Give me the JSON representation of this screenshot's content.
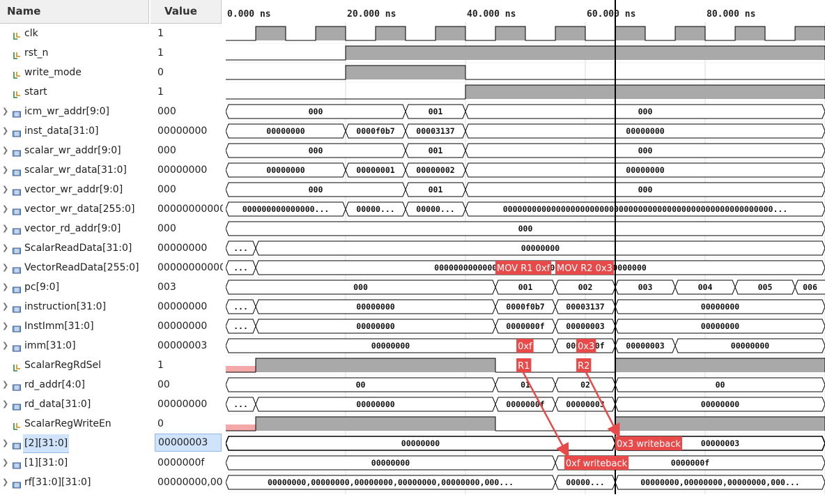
{
  "header": {
    "name_col": "Name",
    "value_col": "Value"
  },
  "time_axis": {
    "labels": [
      "0.000 ns",
      "20.000 ns",
      "40.000 ns",
      "60.000 ns",
      "80.000 ns"
    ],
    "cursor_ns": 65
  },
  "signals": [
    {
      "name": "clk",
      "value": "1",
      "kind": "bit",
      "expandable": false
    },
    {
      "name": "rst_n",
      "value": "1",
      "kind": "bit",
      "expandable": false
    },
    {
      "name": "write_mode",
      "value": "0",
      "kind": "bit",
      "expandable": false
    },
    {
      "name": "start",
      "value": "1",
      "kind": "bit",
      "expandable": false
    },
    {
      "name": "icm_wr_addr[9:0]",
      "value": "000",
      "kind": "bus",
      "expandable": true
    },
    {
      "name": "inst_data[31:0]",
      "value": "00000000",
      "kind": "bus",
      "expandable": true
    },
    {
      "name": "scalar_wr_addr[9:0]",
      "value": "000",
      "kind": "bus",
      "expandable": true
    },
    {
      "name": "scalar_wr_data[31:0]",
      "value": "00000000",
      "kind": "bus",
      "expandable": true
    },
    {
      "name": "vector_wr_addr[9:0]",
      "value": "000",
      "kind": "bus",
      "expandable": true
    },
    {
      "name": "vector_wr_data[255:0]",
      "value": "00000000000",
      "kind": "bus",
      "expandable": true
    },
    {
      "name": "vector_rd_addr[9:0]",
      "value": "000",
      "kind": "bus",
      "expandable": true
    },
    {
      "name": "ScalarReadData[31:0]",
      "value": "00000000",
      "kind": "bus",
      "expandable": true
    },
    {
      "name": "VectorReadData[255:0]",
      "value": "00000000000",
      "kind": "bus",
      "expandable": true
    },
    {
      "name": "pc[9:0]",
      "value": "003",
      "kind": "bus",
      "expandable": true
    },
    {
      "name": "instruction[31:0]",
      "value": "00000000",
      "kind": "bus",
      "expandable": true
    },
    {
      "name": "InstImm[31:0]",
      "value": "00000000",
      "kind": "bus",
      "expandable": true
    },
    {
      "name": "imm[31:0]",
      "value": "00000003",
      "kind": "bus",
      "expandable": true
    },
    {
      "name": "ScalarRegRdSel",
      "value": "1",
      "kind": "bit",
      "expandable": false
    },
    {
      "name": "rd_addr[4:0]",
      "value": "00",
      "kind": "bus",
      "expandable": true
    },
    {
      "name": "rd_data[31:0]",
      "value": "00000000",
      "kind": "bus",
      "expandable": true
    },
    {
      "name": "ScalarRegWriteEn",
      "value": "0",
      "kind": "bit",
      "expandable": false
    },
    {
      "name": "[2][31:0]",
      "value": "00000003",
      "kind": "bus",
      "expandable": true,
      "selected": true
    },
    {
      "name": "[1][31:0]",
      "value": "0000000f",
      "kind": "bus",
      "expandable": true
    },
    {
      "name": "rf[31:0][31:0]",
      "value": "00000000,000",
      "kind": "bus",
      "expandable": true
    }
  ],
  "waves": [
    {
      "type": "clock",
      "half_period_ns": 5,
      "first_edge_ns": 5
    },
    {
      "type": "bit",
      "init": 0,
      "edges_ns": [
        20
      ]
    },
    {
      "type": "bit",
      "init": 0,
      "edges_ns": [
        20,
        40
      ]
    },
    {
      "type": "bit",
      "init": 0,
      "edges_ns": [
        40
      ]
    },
    {
      "type": "bus",
      "segs": [
        {
          "s": 0,
          "e": 30,
          "t": "000"
        },
        {
          "s": 30,
          "e": 40,
          "t": "001"
        },
        {
          "s": 40,
          "e": 100,
          "t": "000"
        }
      ]
    },
    {
      "type": "bus",
      "segs": [
        {
          "s": 0,
          "e": 20,
          "t": "00000000"
        },
        {
          "s": 20,
          "e": 30,
          "t": "0000f0b7"
        },
        {
          "s": 30,
          "e": 40,
          "t": "00003137"
        },
        {
          "s": 40,
          "e": 100,
          "t": "00000000"
        }
      ]
    },
    {
      "type": "bus",
      "segs": [
        {
          "s": 0,
          "e": 30,
          "t": "000"
        },
        {
          "s": 30,
          "e": 40,
          "t": "001"
        },
        {
          "s": 40,
          "e": 100,
          "t": "000"
        }
      ]
    },
    {
      "type": "bus",
      "segs": [
        {
          "s": 0,
          "e": 20,
          "t": "00000000"
        },
        {
          "s": 20,
          "e": 30,
          "t": "00000001"
        },
        {
          "s": 30,
          "e": 40,
          "t": "00000002"
        },
        {
          "s": 40,
          "e": 100,
          "t": "00000000"
        }
      ]
    },
    {
      "type": "bus",
      "segs": [
        {
          "s": 0,
          "e": 30,
          "t": "000"
        },
        {
          "s": 30,
          "e": 40,
          "t": "001"
        },
        {
          "s": 40,
          "e": 100,
          "t": "000"
        }
      ]
    },
    {
      "type": "bus",
      "segs": [
        {
          "s": 0,
          "e": 20,
          "t": "000000000000000..."
        },
        {
          "s": 20,
          "e": 30,
          "t": "00000..."
        },
        {
          "s": 30,
          "e": 40,
          "t": "00000..."
        },
        {
          "s": 40,
          "e": 100,
          "t": "00000000000000000000000000000000000000000000000000000000..."
        }
      ]
    },
    {
      "type": "bus",
      "segs": [
        {
          "s": 0,
          "e": 100,
          "t": "000"
        }
      ]
    },
    {
      "type": "bus",
      "segs": [
        {
          "s": 0,
          "e": 5,
          "t": "...",
          "x": true
        },
        {
          "s": 5,
          "e": 100,
          "t": "00000000"
        }
      ]
    },
    {
      "type": "bus",
      "segs": [
        {
          "s": 0,
          "e": 5,
          "t": "...",
          "x": true
        },
        {
          "s": 5,
          "e": 100,
          "t": "00000000000000000000000000000000000000000000"
        }
      ]
    },
    {
      "type": "bus",
      "segs": [
        {
          "s": 0,
          "e": 45,
          "t": "000"
        },
        {
          "s": 45,
          "e": 55,
          "t": "001"
        },
        {
          "s": 55,
          "e": 65,
          "t": "002"
        },
        {
          "s": 65,
          "e": 75,
          "t": "003"
        },
        {
          "s": 75,
          "e": 85,
          "t": "004"
        },
        {
          "s": 85,
          "e": 95,
          "t": "005"
        },
        {
          "s": 95,
          "e": 105,
          "t": "006"
        }
      ]
    },
    {
      "type": "bus",
      "segs": [
        {
          "s": 0,
          "e": 5,
          "t": "...",
          "x": true
        },
        {
          "s": 5,
          "e": 45,
          "t": "00000000"
        },
        {
          "s": 45,
          "e": 55,
          "t": "0000f0b7"
        },
        {
          "s": 55,
          "e": 65,
          "t": "00003137"
        },
        {
          "s": 65,
          "e": 100,
          "t": "00000000"
        }
      ]
    },
    {
      "type": "bus",
      "segs": [
        {
          "s": 0,
          "e": 5,
          "t": "...",
          "x": true
        },
        {
          "s": 5,
          "e": 45,
          "t": "00000000"
        },
        {
          "s": 45,
          "e": 55,
          "t": "0000000f"
        },
        {
          "s": 55,
          "e": 65,
          "t": "00000003"
        },
        {
          "s": 65,
          "e": 100,
          "t": "00000000"
        }
      ]
    },
    {
      "type": "bus",
      "segs": [
        {
          "s": 0,
          "e": 55,
          "t": "00000000"
        },
        {
          "s": 55,
          "e": 65,
          "t": "0000000f"
        },
        {
          "s": 65,
          "e": 75,
          "t": "00000003"
        },
        {
          "s": 75,
          "e": 100,
          "t": "00000000"
        }
      ]
    },
    {
      "type": "bit",
      "init": "x",
      "edges_ns": [
        5,
        45,
        65
      ]
    },
    {
      "type": "bus",
      "segs": [
        {
          "s": 0,
          "e": 45,
          "t": "00"
        },
        {
          "s": 45,
          "e": 55,
          "t": "01"
        },
        {
          "s": 55,
          "e": 65,
          "t": "02"
        },
        {
          "s": 65,
          "e": 100,
          "t": "00"
        }
      ]
    },
    {
      "type": "bus",
      "segs": [
        {
          "s": 0,
          "e": 5,
          "t": "...",
          "x": true
        },
        {
          "s": 5,
          "e": 45,
          "t": "00000000"
        },
        {
          "s": 45,
          "e": 55,
          "t": "0000000f"
        },
        {
          "s": 55,
          "e": 65,
          "t": "00000003"
        },
        {
          "s": 65,
          "e": 100,
          "t": "00000000"
        }
      ]
    },
    {
      "type": "bit",
      "init": "x",
      "edges_ns": [
        5,
        45,
        65
      ]
    },
    {
      "type": "bus",
      "bold": true,
      "segs": [
        {
          "s": 0,
          "e": 65,
          "t": "00000000"
        },
        {
          "s": 65,
          "e": 100,
          "t": "00000003"
        }
      ]
    },
    {
      "type": "bus",
      "segs": [
        {
          "s": 0,
          "e": 55,
          "t": "00000000"
        },
        {
          "s": 55,
          "e": 100,
          "t": "0000000f"
        }
      ]
    },
    {
      "type": "bus",
      "segs": [
        {
          "s": 0,
          "e": 55,
          "t": "00000000,00000000,00000000,00000000,00000000,000..."
        },
        {
          "s": 55,
          "e": 65,
          "t": "00000..."
        },
        {
          "s": 65,
          "e": 100,
          "t": "00000000,00000000,00000000,000..."
        }
      ]
    }
  ],
  "annotations": [
    {
      "text": "MOV R1 0xf",
      "row": 12,
      "at_ns": 45
    },
    {
      "text": "MOV R2 0x3",
      "row": 12,
      "at_ns": 55
    },
    {
      "text": "0xf",
      "row": 16,
      "at_ns": 48.5
    },
    {
      "text": "0x3",
      "row": 16,
      "at_ns": 58.5
    },
    {
      "text": "R1",
      "row": 17,
      "at_ns": 48.5
    },
    {
      "text": "R2",
      "row": 17,
      "at_ns": 58.5
    },
    {
      "text": "0x3 writeback",
      "row": 21,
      "at_ns": 65
    },
    {
      "text": "0xf writeback",
      "row": 22,
      "at_ns": 56.5
    }
  ],
  "arrows": [
    {
      "from_row": 17,
      "from_ns": 49.5,
      "to_row": 22,
      "to_ns": 57
    },
    {
      "from_row": 17,
      "from_ns": 60,
      "to_row": 21,
      "to_ns": 65.5
    }
  ],
  "colors": {
    "wave_fill": "#a9a9a9",
    "wave_line": "#000000",
    "grid": "#d8d8d8",
    "cursor": "#000000",
    "undefined": "#f4a8a8",
    "annotation_bg": "#e84a4a",
    "annotation_text": "#ffffff",
    "selected_bg": "#cfe3fa",
    "header_bg": "#f0f0f0"
  }
}
